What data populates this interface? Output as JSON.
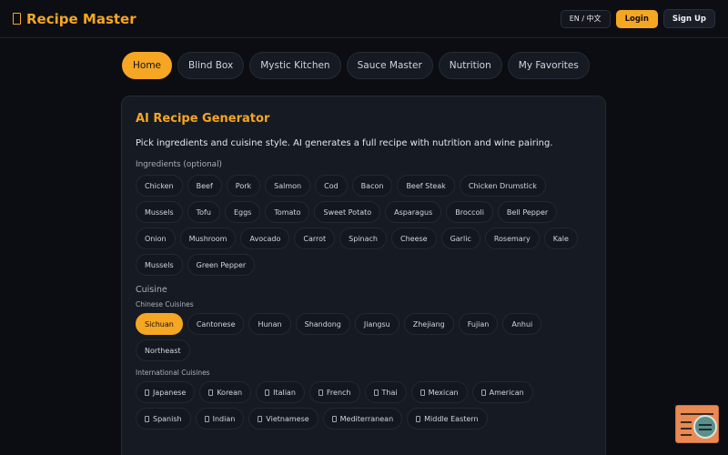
{
  "app": {
    "title": "Recipe Master"
  },
  "header": {
    "lang": "EN / 中文",
    "login": "Login",
    "signup": "Sign Up"
  },
  "nav": {
    "tabs": [
      {
        "label": "Home",
        "active": true
      },
      {
        "label": "Blind Box"
      },
      {
        "label": "Mystic Kitchen"
      },
      {
        "label": "Sauce Master"
      },
      {
        "label": "Nutrition"
      },
      {
        "label": "My Favorites"
      }
    ]
  },
  "generator": {
    "title": "AI Recipe Generator",
    "description": "Pick ingredients and cuisine style. AI generates a full recipe with nutrition and wine pairing.",
    "ingredients_label": "Ingredients (optional)",
    "ingredients": [
      "Chicken",
      "Beef",
      "Pork",
      "Salmon",
      "Cod",
      "Bacon",
      "Beef Steak",
      "Chicken Drumstick",
      "Mussels",
      "Tofu",
      "Eggs",
      "Tomato",
      "Sweet Potato",
      "Asparagus",
      "Broccoli",
      "Bell Pepper",
      "Onion",
      "Mushroom",
      "Avocado",
      "Carrot",
      "Spinach",
      "Cheese",
      "Garlic",
      "Rosemary",
      "Kale",
      "Mussels",
      "Green Pepper"
    ],
    "cuisine_label": "Cuisine",
    "chinese_label": "Chinese Cuisines",
    "chinese": [
      "Sichuan",
      "Cantonese",
      "Hunan",
      "Shandong",
      "Jiangsu",
      "Zhejiang",
      "Fujian",
      "Anhui",
      "Northeast"
    ],
    "chinese_selected": "Sichuan",
    "international_label": "International Cuisines",
    "international": [
      "Japanese",
      "Korean",
      "Italian",
      "French",
      "Thai",
      "Mexican",
      "American",
      "Spanish",
      "Indian",
      "Vietnamese",
      "Mediterranean",
      "Middle Eastern"
    ]
  },
  "icons": {
    "brand": "recipe-book-icon",
    "flag": "flag-icon",
    "widget": "code-assistant-icon"
  },
  "colors": {
    "accent": "#f5a623",
    "background": "#0b0d12",
    "card": "#161a22"
  }
}
